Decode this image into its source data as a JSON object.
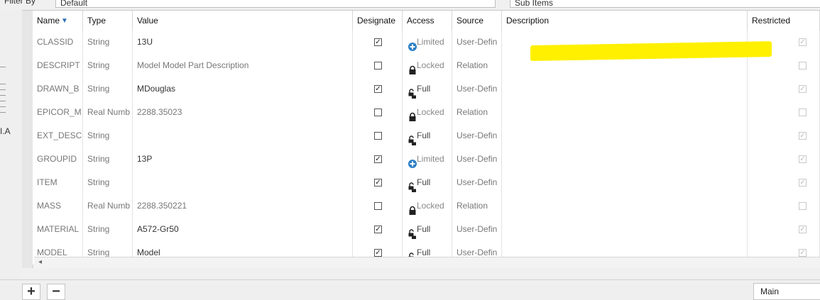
{
  "filter": {
    "label": "Filter By",
    "value": "Default"
  },
  "subitems": {
    "label": "Sub Items"
  },
  "left_panel_cut_text": "I.A",
  "columns": [
    "Name",
    "Type",
    "Value",
    "Designate",
    "Access",
    "Source",
    "Description",
    "Restricted"
  ],
  "sort_indicator": "filter-sort-icon",
  "rows": [
    {
      "name": "CLASSID",
      "type": "String",
      "value": "13U",
      "designated": true,
      "access": "Limited",
      "access_icon": "plus-circle-icon",
      "source": "User-Defin",
      "description": "",
      "restricted": true,
      "name_dim": false
    },
    {
      "name": "DESCRIPT",
      "type": "String",
      "value": "Model Model Part Description",
      "designated": false,
      "access": "Locked",
      "access_icon": "lock-icon",
      "source": "Relation",
      "description": "",
      "restricted": false,
      "value_dim": true
    },
    {
      "name": "DRAWN_B",
      "type": "String",
      "value": "MDouglas",
      "designated": true,
      "access": "Full",
      "access_icon": "unlock-icon",
      "source": "User-Defin",
      "description": "",
      "restricted": true
    },
    {
      "name": "EPICOR_M",
      "type": "Real Numb",
      "value": "2288.35023",
      "designated": false,
      "access": "Locked",
      "access_icon": "lock-icon",
      "source": "Relation",
      "description": "",
      "restricted": false,
      "value_dim": true
    },
    {
      "name": "EXT_DESC",
      "type": "String",
      "value": "",
      "designated": false,
      "access": "Full",
      "access_icon": "unlock-icon",
      "source": "User-Defin",
      "description": "",
      "restricted": true
    },
    {
      "name": "GROUPID",
      "type": "String",
      "value": "13P",
      "designated": true,
      "access": "Limited",
      "access_icon": "plus-circle-icon",
      "source": "User-Defin",
      "description": "",
      "restricted": true
    },
    {
      "name": "ITEM",
      "type": "String",
      "value": "",
      "designated": true,
      "access": "Full",
      "access_icon": "unlock-icon",
      "source": "User-Defin",
      "description": "",
      "restricted": true
    },
    {
      "name": "MASS",
      "type": "Real Numb",
      "value": "2288.350221",
      "designated": false,
      "access": "Locked",
      "access_icon": "lock-icon",
      "source": "Relation",
      "description": "",
      "restricted": false,
      "value_dim": true
    },
    {
      "name": "MATERIAL",
      "type": "String",
      "value": "A572-Gr50",
      "designated": true,
      "access": "Full",
      "access_icon": "unlock-icon",
      "source": "User-Defin",
      "description": "",
      "restricted": true
    },
    {
      "name": "MODEL",
      "type": "String",
      "value": "Model",
      "designated": true,
      "access": "Full",
      "access_icon": "unlock-icon",
      "source": "User-Defin",
      "description": "",
      "restricted": true
    }
  ],
  "buttons": {
    "add": "+",
    "remove": "−"
  },
  "bottom_tab": "Main",
  "colors": {
    "highlight": "#fff000",
    "accent": "#2d6fb5"
  }
}
